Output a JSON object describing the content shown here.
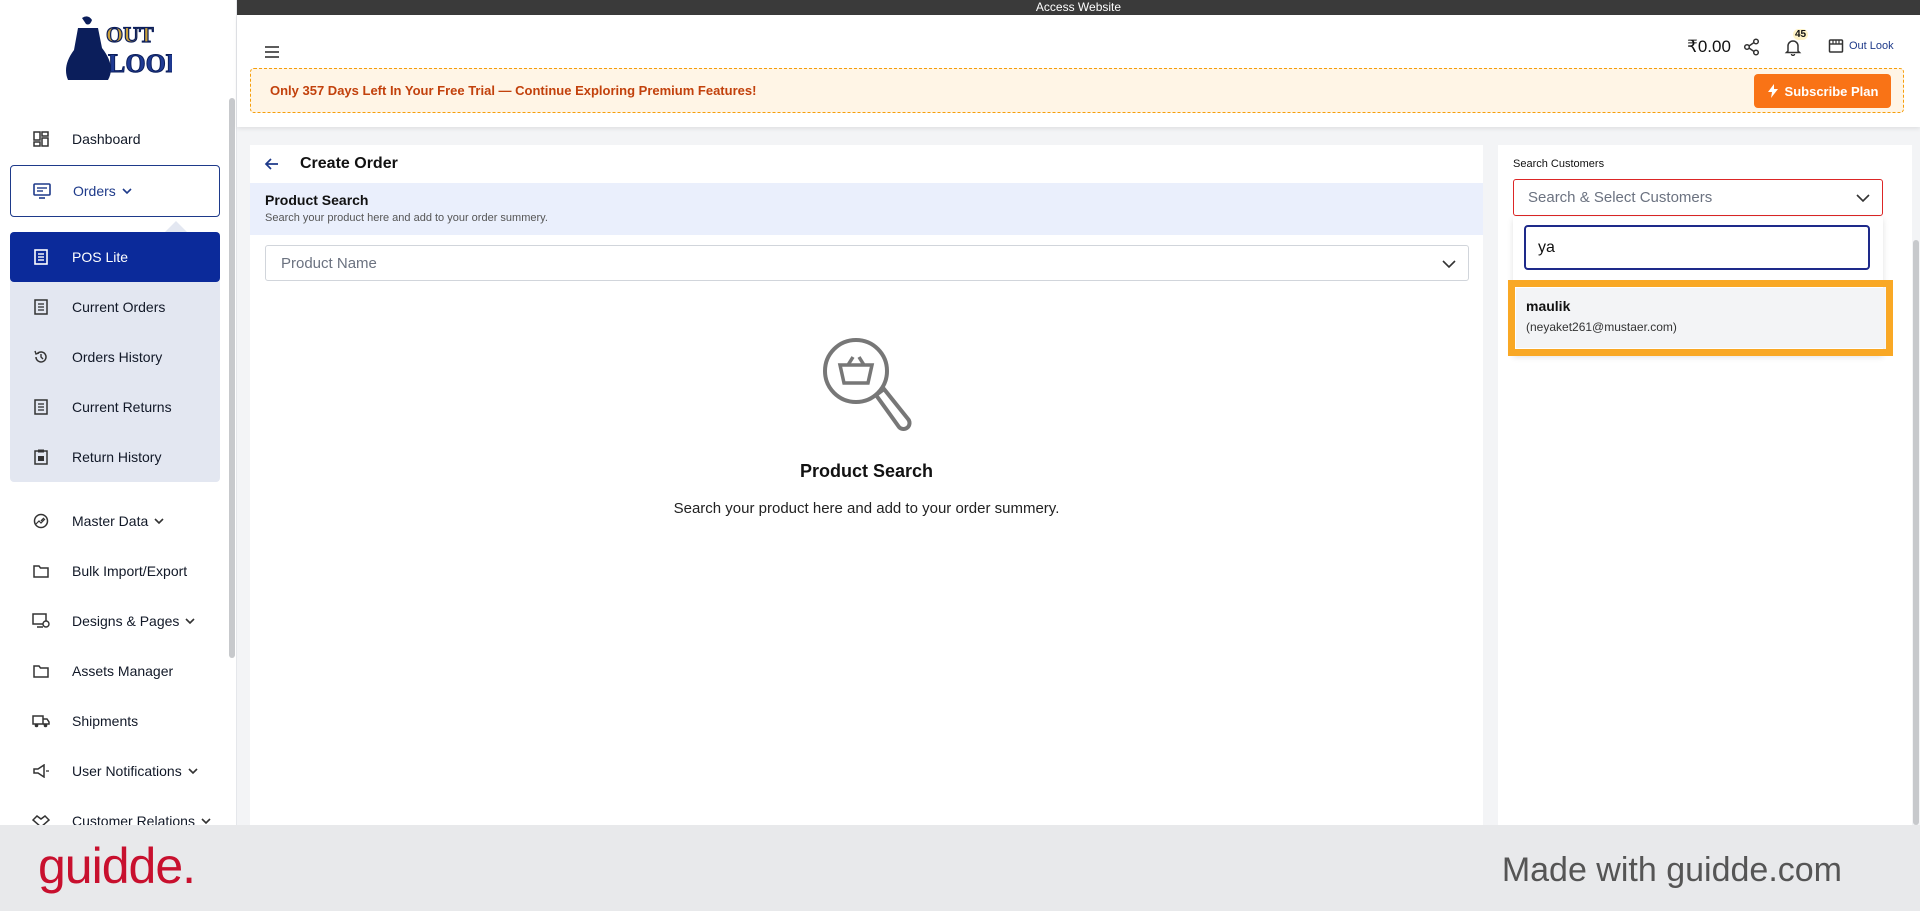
{
  "topbar": {
    "access_label": "Access Website"
  },
  "header": {
    "balance": "₹0.00",
    "notification_count": "45",
    "store_name": "Out Look",
    "trial_text": "Only 357 Days Left In Your Free Trial — Continue Exploring Premium Features!",
    "subscribe_label": "Subscribe Plan"
  },
  "logo": {
    "line1": "OUT",
    "line2": "LOOK"
  },
  "sidebar": {
    "items": [
      {
        "label": "Dashboard",
        "icon": "dashboard-icon"
      },
      {
        "label": "Orders",
        "icon": "monitor-icon",
        "expanded": true
      },
      {
        "label": "POS Lite",
        "icon": "receipt-icon",
        "active": true
      },
      {
        "label": "Current Orders",
        "icon": "list-icon"
      },
      {
        "label": "Orders History",
        "icon": "history-icon"
      },
      {
        "label": "Current Returns",
        "icon": "list-icon"
      },
      {
        "label": "Return History",
        "icon": "clipboard-icon"
      },
      {
        "label": "Master Data",
        "icon": "gauge-icon"
      },
      {
        "label": "Bulk Import/Export",
        "icon": "folder-icon"
      },
      {
        "label": "Designs & Pages",
        "icon": "design-icon"
      },
      {
        "label": "Assets Manager",
        "icon": "folder-icon"
      },
      {
        "label": "Shipments",
        "icon": "truck-icon"
      },
      {
        "label": "User Notifications",
        "icon": "megaphone-icon"
      },
      {
        "label": "Customer Relations",
        "icon": "handshake-icon"
      }
    ]
  },
  "main": {
    "title": "Create Order",
    "search_head_title": "Product Search",
    "search_head_sub": "Search your product here and add to your order summery.",
    "product_placeholder": "Product Name",
    "empty_title": "Product Search",
    "empty_sub": "Search your product here and add to your order summery."
  },
  "customers": {
    "label": "Search Customers",
    "placeholder": "Search & Select Customers",
    "search_value": "ya",
    "results": [
      {
        "name": "maulik",
        "email": "(neyaket261@mustaer.com)"
      }
    ]
  },
  "footer": {
    "brand": "guidde.",
    "made_with": "Made with guidde.com"
  },
  "colors": {
    "primary": "#0b2a9a",
    "accent": "#f97316",
    "highlight": "#f9a825",
    "brand_red": "#c8102e"
  }
}
